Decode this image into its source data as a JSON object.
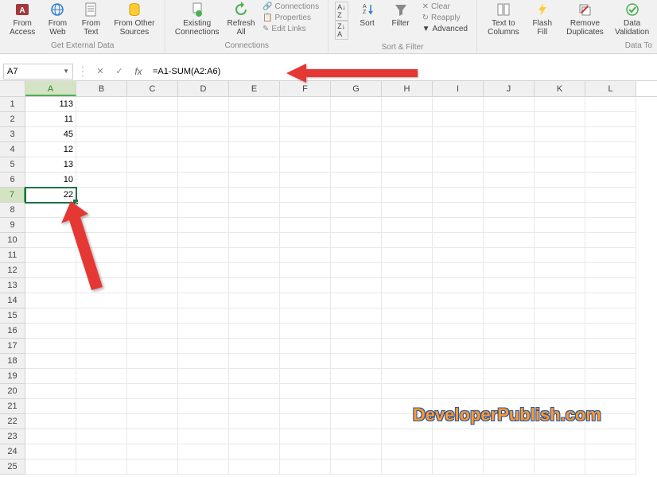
{
  "ribbon": {
    "groups": {
      "external_data": {
        "label": "Get External Data",
        "items": [
          "From\nAccess",
          "From\nWeb",
          "From\nText",
          "From Other\nSources"
        ]
      },
      "connections": {
        "label": "Connections",
        "items": [
          "Existing\nConnections",
          "Refresh\nAll"
        ],
        "small": [
          "Connections",
          "Properties",
          "Edit Links"
        ]
      },
      "sort_filter": {
        "label": "Sort & Filter",
        "sort": "Sort",
        "filter": "Filter",
        "small": [
          "Clear",
          "Reapply",
          "Advanced"
        ]
      },
      "data_tools": {
        "label": "Data To",
        "items": [
          "Text to\nColumns",
          "Flash\nFill",
          "Remove\nDuplicates",
          "Data\nValidation"
        ]
      }
    }
  },
  "name_box": "A7",
  "formula": "=A1-SUM(A2:A6)",
  "columns": [
    "A",
    "B",
    "C",
    "D",
    "E",
    "F",
    "G",
    "H",
    "I",
    "J",
    "K",
    "L"
  ],
  "selected_col": 0,
  "cells": {
    "A1": "113",
    "A2": "11",
    "A3": "45",
    "A4": "12",
    "A5": "13",
    "A6": "10",
    "A7": "22"
  },
  "selected_row": 7,
  "num_rows": 25,
  "watermark": "DeveloperPublish.com",
  "chart_data": {
    "type": "table",
    "title": "Excel worksheet showing subtraction via SUM formula",
    "formula": "=A1-SUM(A2:A6)",
    "active_cell": "A7",
    "columns": [
      "A"
    ],
    "rows": [
      {
        "row": 1,
        "A": 113
      },
      {
        "row": 2,
        "A": 11
      },
      {
        "row": 3,
        "A": 45
      },
      {
        "row": 4,
        "A": 12
      },
      {
        "row": 5,
        "A": 13
      },
      {
        "row": 6,
        "A": 10
      },
      {
        "row": 7,
        "A": 22
      }
    ]
  }
}
